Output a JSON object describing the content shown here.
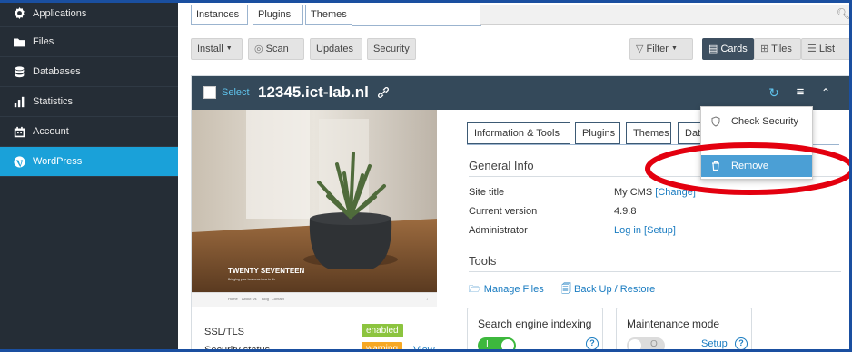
{
  "sidebar": {
    "items": [
      {
        "label": "Applications",
        "icon": "gear-icon",
        "active": false
      },
      {
        "label": "Files",
        "icon": "folder-icon",
        "active": false
      },
      {
        "label": "Databases",
        "icon": "database-icon",
        "active": false
      },
      {
        "label": "Statistics",
        "icon": "bar-chart-icon",
        "active": false
      },
      {
        "label": "Account",
        "icon": "calendar-icon",
        "active": false
      },
      {
        "label": "WordPress",
        "icon": "wordpress-icon",
        "active": true
      }
    ],
    "active_color": "#1aa1d9"
  },
  "tabs": [
    "Instances",
    "Plugins",
    "Themes"
  ],
  "toolbar": {
    "install": "Install",
    "scan": "Scan",
    "updates": "Updates",
    "security": "Security",
    "filter": "Filter",
    "cards": "Cards",
    "tiles": "Tiles",
    "list": "List"
  },
  "card": {
    "select_label": "Select",
    "title": "12345.ict-lab.nl",
    "preview": {
      "theme_name": "TWENTY SEVENTEEN",
      "tagline": "Bringing your business idea to life",
      "nav": [
        "Home",
        "About Us",
        "Blog",
        "Contact"
      ]
    },
    "status": [
      {
        "label": "SSL/TLS",
        "badge": "enabled",
        "badge_color": "#8cc43f"
      },
      {
        "label": "Security status",
        "badge": "warning",
        "badge_color": "#f7a823",
        "link": "View"
      }
    ],
    "panel_tabs": [
      "Information & Tools",
      "Plugins",
      "Themes",
      "Dat"
    ],
    "general_info": {
      "heading": "General Info",
      "rows": [
        {
          "key": "Site title",
          "value": "My CMS",
          "link": "[Change]"
        },
        {
          "key": "Current version",
          "value": "4.9.8"
        },
        {
          "key": "Administrator",
          "value": "Log in",
          "link": "[Setup]"
        }
      ]
    },
    "tools": {
      "heading": "Tools",
      "manage_files": "Manage Files",
      "backup": "Back Up / Restore"
    },
    "search_indexing": {
      "title": "Search engine indexing",
      "enabled": true
    },
    "maintenance": {
      "title": "Maintenance mode",
      "enabled": false,
      "setup": "Setup"
    }
  },
  "menu": {
    "items": [
      {
        "label": "Check Security",
        "icon": "shield-icon",
        "highlighted": false
      },
      {
        "label": "Remove",
        "icon": "trash-icon",
        "highlighted": true
      }
    ]
  },
  "annotation_color": "#e3000f"
}
